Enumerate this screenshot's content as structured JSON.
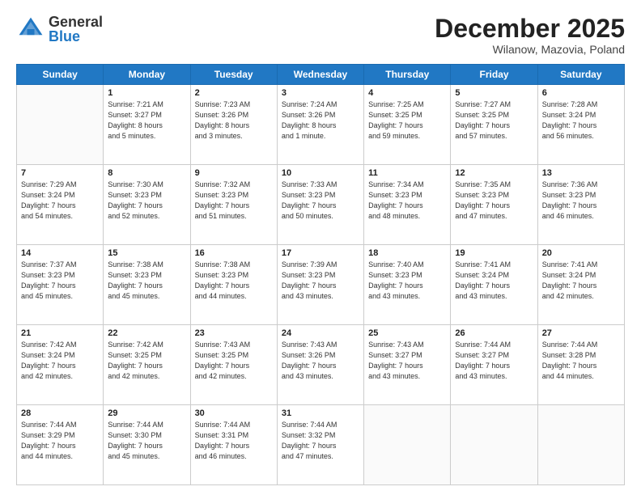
{
  "header": {
    "logo_general": "General",
    "logo_blue": "Blue",
    "month_title": "December 2025",
    "location": "Wilanow, Mazovia, Poland"
  },
  "days_of_week": [
    "Sunday",
    "Monday",
    "Tuesday",
    "Wednesday",
    "Thursday",
    "Friday",
    "Saturday"
  ],
  "weeks": [
    [
      {
        "day": "",
        "info": ""
      },
      {
        "day": "1",
        "info": "Sunrise: 7:21 AM\nSunset: 3:27 PM\nDaylight: 8 hours\nand 5 minutes."
      },
      {
        "day": "2",
        "info": "Sunrise: 7:23 AM\nSunset: 3:26 PM\nDaylight: 8 hours\nand 3 minutes."
      },
      {
        "day": "3",
        "info": "Sunrise: 7:24 AM\nSunset: 3:26 PM\nDaylight: 8 hours\nand 1 minute."
      },
      {
        "day": "4",
        "info": "Sunrise: 7:25 AM\nSunset: 3:25 PM\nDaylight: 7 hours\nand 59 minutes."
      },
      {
        "day": "5",
        "info": "Sunrise: 7:27 AM\nSunset: 3:25 PM\nDaylight: 7 hours\nand 57 minutes."
      },
      {
        "day": "6",
        "info": "Sunrise: 7:28 AM\nSunset: 3:24 PM\nDaylight: 7 hours\nand 56 minutes."
      }
    ],
    [
      {
        "day": "7",
        "info": "Sunrise: 7:29 AM\nSunset: 3:24 PM\nDaylight: 7 hours\nand 54 minutes."
      },
      {
        "day": "8",
        "info": "Sunrise: 7:30 AM\nSunset: 3:23 PM\nDaylight: 7 hours\nand 52 minutes."
      },
      {
        "day": "9",
        "info": "Sunrise: 7:32 AM\nSunset: 3:23 PM\nDaylight: 7 hours\nand 51 minutes."
      },
      {
        "day": "10",
        "info": "Sunrise: 7:33 AM\nSunset: 3:23 PM\nDaylight: 7 hours\nand 50 minutes."
      },
      {
        "day": "11",
        "info": "Sunrise: 7:34 AM\nSunset: 3:23 PM\nDaylight: 7 hours\nand 48 minutes."
      },
      {
        "day": "12",
        "info": "Sunrise: 7:35 AM\nSunset: 3:23 PM\nDaylight: 7 hours\nand 47 minutes."
      },
      {
        "day": "13",
        "info": "Sunrise: 7:36 AM\nSunset: 3:23 PM\nDaylight: 7 hours\nand 46 minutes."
      }
    ],
    [
      {
        "day": "14",
        "info": "Sunrise: 7:37 AM\nSunset: 3:23 PM\nDaylight: 7 hours\nand 45 minutes."
      },
      {
        "day": "15",
        "info": "Sunrise: 7:38 AM\nSunset: 3:23 PM\nDaylight: 7 hours\nand 45 minutes."
      },
      {
        "day": "16",
        "info": "Sunrise: 7:38 AM\nSunset: 3:23 PM\nDaylight: 7 hours\nand 44 minutes."
      },
      {
        "day": "17",
        "info": "Sunrise: 7:39 AM\nSunset: 3:23 PM\nDaylight: 7 hours\nand 43 minutes."
      },
      {
        "day": "18",
        "info": "Sunrise: 7:40 AM\nSunset: 3:23 PM\nDaylight: 7 hours\nand 43 minutes."
      },
      {
        "day": "19",
        "info": "Sunrise: 7:41 AM\nSunset: 3:24 PM\nDaylight: 7 hours\nand 43 minutes."
      },
      {
        "day": "20",
        "info": "Sunrise: 7:41 AM\nSunset: 3:24 PM\nDaylight: 7 hours\nand 42 minutes."
      }
    ],
    [
      {
        "day": "21",
        "info": "Sunrise: 7:42 AM\nSunset: 3:24 PM\nDaylight: 7 hours\nand 42 minutes."
      },
      {
        "day": "22",
        "info": "Sunrise: 7:42 AM\nSunset: 3:25 PM\nDaylight: 7 hours\nand 42 minutes."
      },
      {
        "day": "23",
        "info": "Sunrise: 7:43 AM\nSunset: 3:25 PM\nDaylight: 7 hours\nand 42 minutes."
      },
      {
        "day": "24",
        "info": "Sunrise: 7:43 AM\nSunset: 3:26 PM\nDaylight: 7 hours\nand 43 minutes."
      },
      {
        "day": "25",
        "info": "Sunrise: 7:43 AM\nSunset: 3:27 PM\nDaylight: 7 hours\nand 43 minutes."
      },
      {
        "day": "26",
        "info": "Sunrise: 7:44 AM\nSunset: 3:27 PM\nDaylight: 7 hours\nand 43 minutes."
      },
      {
        "day": "27",
        "info": "Sunrise: 7:44 AM\nSunset: 3:28 PM\nDaylight: 7 hours\nand 44 minutes."
      }
    ],
    [
      {
        "day": "28",
        "info": "Sunrise: 7:44 AM\nSunset: 3:29 PM\nDaylight: 7 hours\nand 44 minutes."
      },
      {
        "day": "29",
        "info": "Sunrise: 7:44 AM\nSunset: 3:30 PM\nDaylight: 7 hours\nand 45 minutes."
      },
      {
        "day": "30",
        "info": "Sunrise: 7:44 AM\nSunset: 3:31 PM\nDaylight: 7 hours\nand 46 minutes."
      },
      {
        "day": "31",
        "info": "Sunrise: 7:44 AM\nSunset: 3:32 PM\nDaylight: 7 hours\nand 47 minutes."
      },
      {
        "day": "",
        "info": ""
      },
      {
        "day": "",
        "info": ""
      },
      {
        "day": "",
        "info": ""
      }
    ]
  ]
}
